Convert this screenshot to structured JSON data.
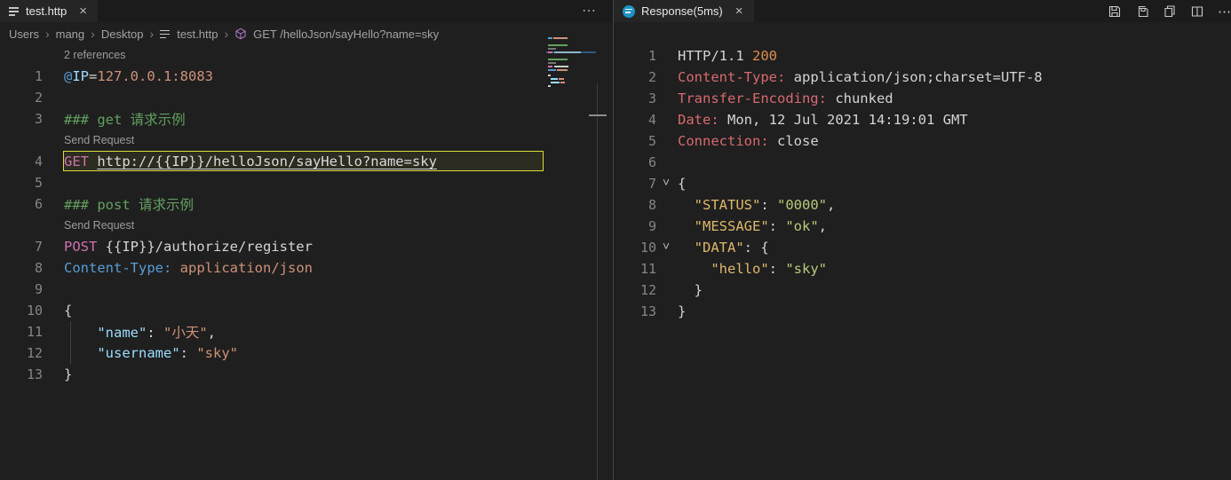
{
  "tabs": {
    "left": {
      "title": "test.http"
    },
    "right": {
      "title": "Response(5ms)"
    }
  },
  "icons": {
    "close": "×",
    "more": "⋯",
    "chevron_down": "˅",
    "breadcrumb_separator": "›"
  },
  "breadcrumb": {
    "items": [
      {
        "label": "Users"
      },
      {
        "label": "mang"
      },
      {
        "label": "Desktop"
      },
      {
        "label": "test.http",
        "icon": "file-icon"
      },
      {
        "label": "GET /helloJson/sayHello?name=sky",
        "icon": "symbol-cube-icon"
      }
    ]
  },
  "editor_left": {
    "rows": [
      {
        "type": "codelens",
        "text": "2 references",
        "link": true,
        "name": "references-codelens"
      },
      {
        "type": "code",
        "num": "1",
        "segs": [
          {
            "t": "@",
            "c": "kw-at"
          },
          {
            "t": "IP",
            "c": "var"
          },
          {
            "t": "=",
            "c": "plain"
          },
          {
            "t": "127.0.0.1:8083",
            "c": "str"
          }
        ]
      },
      {
        "type": "code",
        "num": "2",
        "segs": []
      },
      {
        "type": "code",
        "num": "3",
        "segs": [
          {
            "t": "### get 请求示例",
            "c": "comment"
          }
        ]
      },
      {
        "type": "codelens",
        "text": "Send Request",
        "link": true,
        "name": "send-request-link"
      },
      {
        "type": "code",
        "num": "4",
        "boxed": true,
        "segs": [
          {
            "t": "GET",
            "c": "method"
          },
          {
            "t": " ",
            "c": "plain"
          },
          {
            "t": "http://{{IP}}/helloJson/sayHello?name=sky",
            "c": "url"
          }
        ]
      },
      {
        "type": "code",
        "num": "5",
        "segs": []
      },
      {
        "type": "code",
        "num": "6",
        "segs": [
          {
            "t": "### post 请求示例",
            "c": "comment"
          }
        ]
      },
      {
        "type": "codelens",
        "text": "Send Request",
        "link": true,
        "name": "send-request-link"
      },
      {
        "type": "code",
        "num": "7",
        "segs": [
          {
            "t": "POST",
            "c": "method"
          },
          {
            "t": " {{IP}}/authorize/register",
            "c": "plain"
          }
        ]
      },
      {
        "type": "code",
        "num": "8",
        "segs": [
          {
            "t": "Content-Type:",
            "c": "hdr-blue"
          },
          {
            "t": " ",
            "c": "plain"
          },
          {
            "t": "application/json",
            "c": "str"
          }
        ]
      },
      {
        "type": "code",
        "num": "9",
        "segs": []
      },
      {
        "type": "code",
        "num": "10",
        "segs": [
          {
            "t": "{",
            "c": "plain"
          }
        ]
      },
      {
        "type": "code",
        "num": "11",
        "guide": true,
        "segs": [
          {
            "t": "    ",
            "c": "plain"
          },
          {
            "t": "\"name\"",
            "c": "key-blue"
          },
          {
            "t": ": ",
            "c": "plain"
          },
          {
            "t": "\"小天\"",
            "c": "str"
          },
          {
            "t": ",",
            "c": "plain"
          }
        ]
      },
      {
        "type": "code",
        "num": "12",
        "guide": true,
        "segs": [
          {
            "t": "    ",
            "c": "plain"
          },
          {
            "t": "\"username\"",
            "c": "key-blue"
          },
          {
            "t": ": ",
            "c": "plain"
          },
          {
            "t": "\"sky\"",
            "c": "str"
          }
        ]
      },
      {
        "type": "code",
        "num": "13",
        "segs": [
          {
            "t": "}",
            "c": "plain"
          }
        ]
      }
    ]
  },
  "editor_right": {
    "rows": [
      {
        "type": "code",
        "num": "1",
        "segs": [
          {
            "t": "HTTP/1.1 ",
            "c": "plain"
          },
          {
            "t": "200",
            "c": "status"
          }
        ]
      },
      {
        "type": "code",
        "num": "2",
        "segs": [
          {
            "t": "Content-Type:",
            "c": "hdr-red"
          },
          {
            "t": " application/json;charset=UTF-8",
            "c": "plain"
          }
        ]
      },
      {
        "type": "code",
        "num": "3",
        "segs": [
          {
            "t": "Transfer-Encoding:",
            "c": "hdr-red"
          },
          {
            "t": " chunked",
            "c": "plain"
          }
        ]
      },
      {
        "type": "code",
        "num": "4",
        "segs": [
          {
            "t": "Date:",
            "c": "hdr-red"
          },
          {
            "t": " Mon, 12 Jul 2021 14:19:01 GMT",
            "c": "plain"
          }
        ]
      },
      {
        "type": "code",
        "num": "5",
        "segs": [
          {
            "t": "Connection:",
            "c": "hdr-red"
          },
          {
            "t": " close",
            "c": "plain"
          }
        ]
      },
      {
        "type": "code",
        "num": "6",
        "segs": []
      },
      {
        "type": "code",
        "num": "7",
        "fold": true,
        "segs": [
          {
            "t": "{",
            "c": "plain"
          }
        ]
      },
      {
        "type": "code",
        "num": "8",
        "segs": [
          {
            "t": "  ",
            "c": "plain"
          },
          {
            "t": "\"STATUS\"",
            "c": "key-gold"
          },
          {
            "t": ": ",
            "c": "plain"
          },
          {
            "t": "\"0000\"",
            "c": "val-green"
          },
          {
            "t": ",",
            "c": "plain"
          }
        ]
      },
      {
        "type": "code",
        "num": "9",
        "segs": [
          {
            "t": "  ",
            "c": "plain"
          },
          {
            "t": "\"MESSAGE\"",
            "c": "key-gold"
          },
          {
            "t": ": ",
            "c": "plain"
          },
          {
            "t": "\"ok\"",
            "c": "val-green"
          },
          {
            "t": ",",
            "c": "plain"
          }
        ]
      },
      {
        "type": "code",
        "num": "10",
        "fold": true,
        "segs": [
          {
            "t": "  ",
            "c": "plain"
          },
          {
            "t": "\"DATA\"",
            "c": "key-gold"
          },
          {
            "t": ": {",
            "c": "plain"
          }
        ]
      },
      {
        "type": "code",
        "num": "11",
        "segs": [
          {
            "t": "    ",
            "c": "plain"
          },
          {
            "t": "\"hello\"",
            "c": "key-gold"
          },
          {
            "t": ": ",
            "c": "plain"
          },
          {
            "t": "\"sky\"",
            "c": "val-green"
          }
        ]
      },
      {
        "type": "code",
        "num": "12",
        "segs": [
          {
            "t": "  }",
            "c": "plain"
          }
        ]
      },
      {
        "type": "code",
        "num": "13",
        "segs": [
          {
            "t": "}",
            "c": "plain"
          }
        ]
      }
    ]
  },
  "editor_action_icons": [
    "save-icon",
    "save-all-icon",
    "copy-icon",
    "split-editor-icon",
    "more-actions-icon"
  ]
}
